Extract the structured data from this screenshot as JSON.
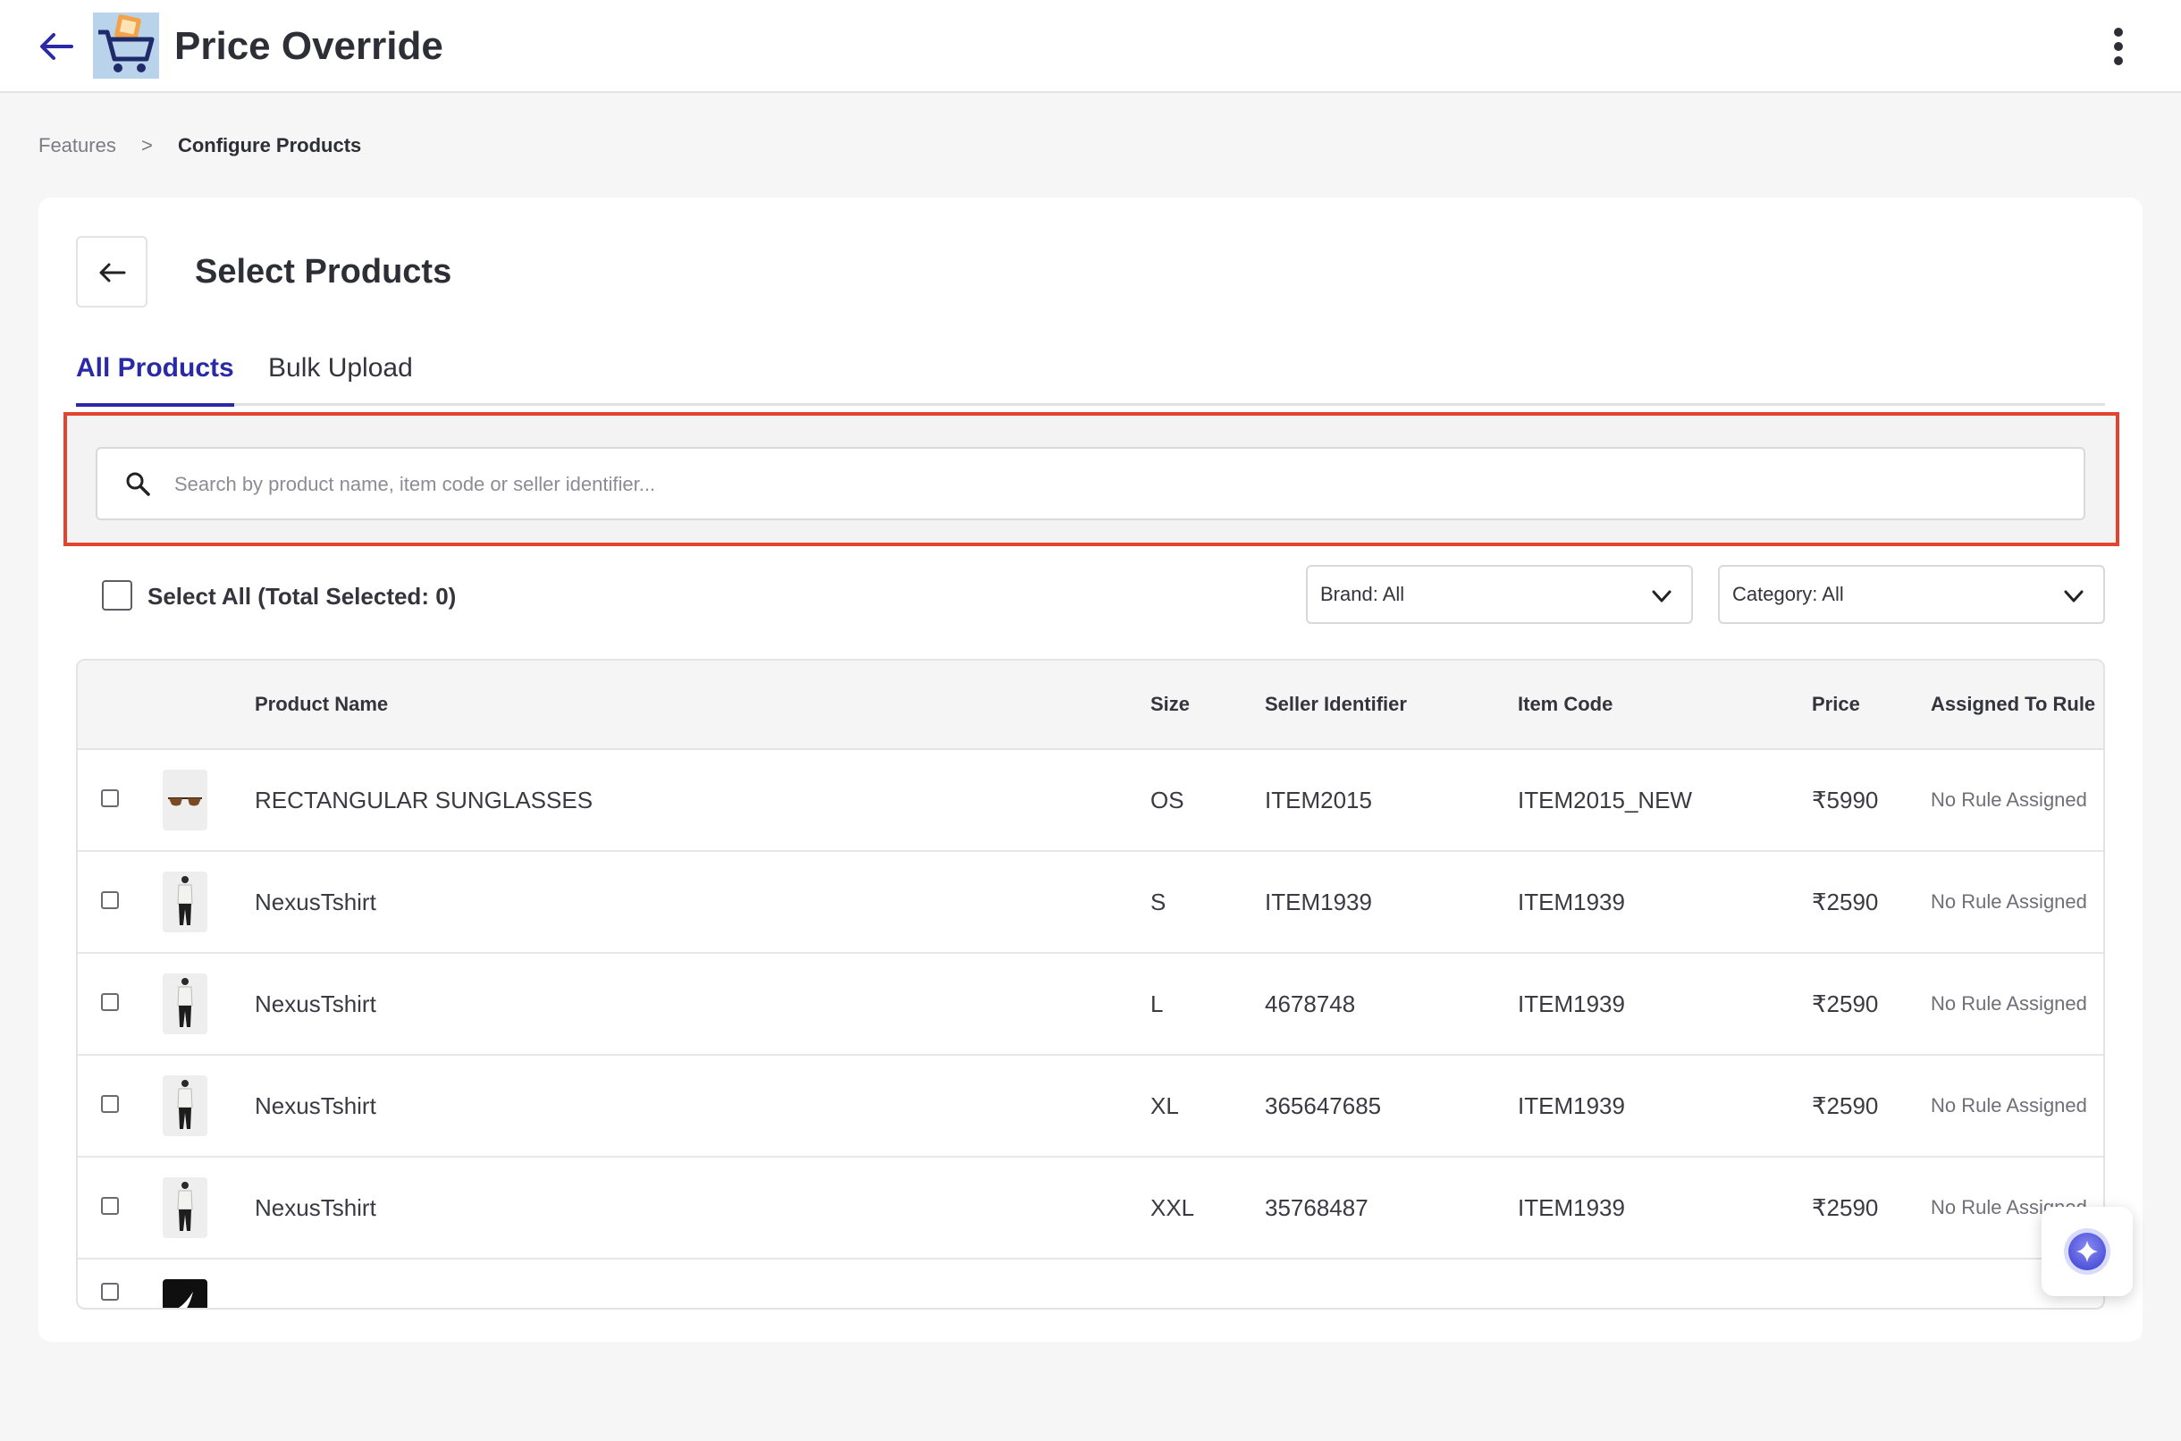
{
  "header": {
    "title": "Price Override",
    "back_icon": "arrow-left-icon",
    "logo_icon": "shopping-cart-logo",
    "menu_icon": "kebab-menu-icon",
    "accent_color": "#2a2aa6"
  },
  "breadcrumb": {
    "items": [
      "Features",
      "Configure Products"
    ],
    "separator": ">"
  },
  "panel": {
    "title": "Select Products",
    "tabs": [
      {
        "label": "All Products",
        "active": true
      },
      {
        "label": "Bulk Upload",
        "active": false
      }
    ],
    "search": {
      "placeholder": "Search by product name, item code or seller identifier...",
      "value": "",
      "highlight_color": "#e24430"
    },
    "select_all_label": "Select All (Total Selected: 0)",
    "filters": {
      "brand": "Brand: All",
      "category": "Category: All"
    }
  },
  "table": {
    "columns": [
      "Product Name",
      "Size",
      "Seller Identifier",
      "Item Code",
      "Price",
      "Assigned To Rule"
    ],
    "rows": [
      {
        "name": "RECTANGULAR SUNGLASSES",
        "size": "OS",
        "seller_id": "ITEM2015",
        "item_code": "ITEM2015_NEW",
        "price": "₹5990",
        "rule": "No Rule Assigned",
        "thumb": "sunglasses"
      },
      {
        "name": "NexusTshirt",
        "size": "S",
        "seller_id": "ITEM1939",
        "item_code": "ITEM1939",
        "price": "₹2590",
        "rule": "No Rule Assigned",
        "thumb": "tshirt-model"
      },
      {
        "name": "NexusTshirt",
        "size": "L",
        "seller_id": "4678748",
        "item_code": "ITEM1939",
        "price": "₹2590",
        "rule": "No Rule Assigned",
        "thumb": "tshirt-model"
      },
      {
        "name": "NexusTshirt",
        "size": "XL",
        "seller_id": "365647685",
        "item_code": "ITEM1939",
        "price": "₹2590",
        "rule": "No Rule Assigned",
        "thumb": "tshirt-model"
      },
      {
        "name": "NexusTshirt",
        "size": "XXL",
        "seller_id": "35768487",
        "item_code": "ITEM1939",
        "price": "₹2590",
        "rule": "No Rule Assigned",
        "thumb": "tshirt-model"
      }
    ]
  },
  "assistant_fab": {
    "icon": "sparkle-assistant-icon"
  }
}
